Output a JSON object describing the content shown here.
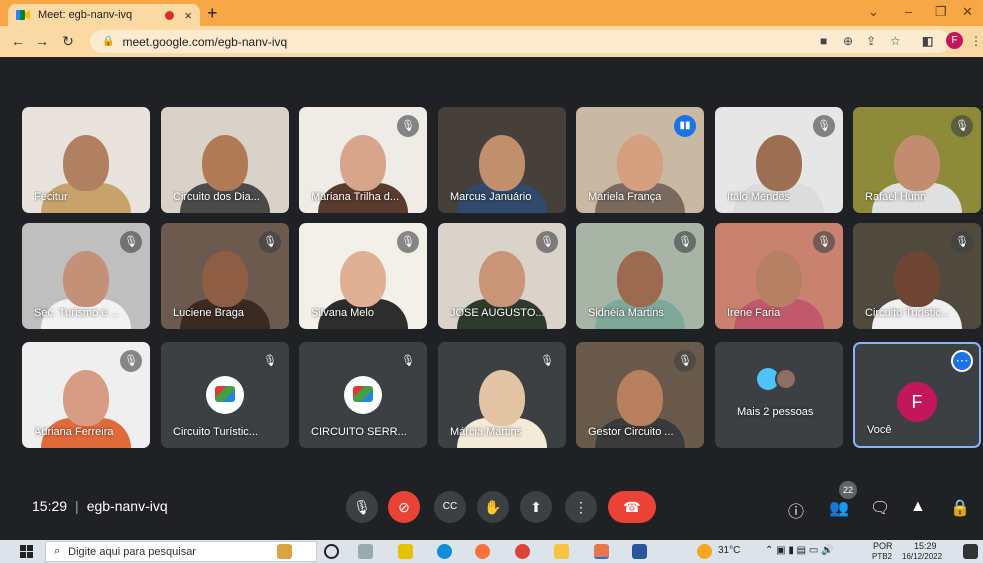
{
  "browser": {
    "tab_title": "Meet: egb-nanv-ivq",
    "tab_close": "×",
    "new_tab": "+",
    "url": "meet.google.com/egb-nanv-ivq",
    "profile_initial": "F"
  },
  "participants": [
    {
      "name": "Fecitur",
      "muted": false,
      "skin": "#b08060",
      "shirt": "#c9a26b",
      "bg": "#e8e3dc"
    },
    {
      "name": "Circuito dos Dia...",
      "muted": false,
      "skin": "#b07a55",
      "shirt": "#4a4a4a",
      "bg": "#d8d2c8"
    },
    {
      "name": "Mariana Trilha d...",
      "muted": true,
      "skin": "#d6a58a",
      "shirt": "#5a3b2e",
      "bg": "#efece7"
    },
    {
      "name": "Marcus Januário",
      "muted": false,
      "skin": "#c28f6c",
      "shirt": "#2f4a6b",
      "bg": "#46403b"
    },
    {
      "name": "Mariela França",
      "muted": false,
      "speaking": true,
      "skin": "#d4a07f",
      "shirt": "#7a6a5e",
      "bg": "#c9b9a2"
    },
    {
      "name": "Italo Mendes",
      "muted": true,
      "skin": "#9c6f52",
      "shirt": "#dcdcdc",
      "bg": "#e6e6e6"
    },
    {
      "name": "Rafael Huhn",
      "muted": true,
      "skin": "#c28d6e",
      "shirt": "#e0e0e0",
      "bg": "#8d8a3a"
    },
    {
      "name": "Sec. Turismo e ...",
      "muted": true,
      "skin": "#c49077",
      "shirt": "#f2f2f2",
      "bg": "#bfbfbf"
    },
    {
      "name": "Luciene Braga",
      "muted": true,
      "skin": "#8f5d43",
      "shirt": "#3b2a22",
      "bg": "#6b5a4d"
    },
    {
      "name": "Silvana Melo",
      "muted": true,
      "skin": "#e0b095",
      "shirt": "#2d2d2d",
      "bg": "#f3efe9"
    },
    {
      "name": "JOSE AUGUSTO...",
      "muted": true,
      "skin": "#c99578",
      "shirt": "#2f3a2f",
      "bg": "#d9d3c9"
    },
    {
      "name": "Sidnéia Martins",
      "muted": true,
      "skin": "#9b6a4f",
      "shirt": "#7fa89a",
      "bg": "#a8b5a6"
    },
    {
      "name": "Irene Faria",
      "muted": true,
      "skin": "#b58064",
      "shirt": "#c0596c",
      "bg": "#c9826f"
    },
    {
      "name": "Circuito Turístic...",
      "muted": true,
      "skin": "#6e4633",
      "shirt": "#f0f0f0",
      "bg": "#4f4a3d"
    },
    {
      "name": "Adriana Ferreira",
      "muted": true,
      "skin": "#d89c85",
      "shirt": "#e26a3a",
      "bg": "#efefef"
    },
    {
      "name": "Circuito Turístic...",
      "muted": true,
      "logo": true
    },
    {
      "name": "CIRCUITO SERR...",
      "muted": true,
      "logo": true
    },
    {
      "name": "Márcia Martins",
      "muted": true,
      "skin": "#e2c4a4",
      "shirt": "#f5ead8",
      "bg": "#3c4043"
    },
    {
      "name": "Gestor Circuito ...",
      "muted": true,
      "skin": "#b8805f",
      "shirt": "#3a3a3a",
      "bg": "#6a5a4b"
    }
  ],
  "more_people": "Mais 2 pessoas",
  "you": {
    "label": "Você",
    "initial": "F"
  },
  "meeting": {
    "time": "15:29",
    "code": "egb-nanv-ivq",
    "participant_count": "22"
  },
  "taskbar": {
    "search_placeholder": "Digite aqui para pesquisar",
    "temperature": "31°C",
    "lang": "POR",
    "lang2": "PTB2",
    "time": "15:29",
    "date": "16/12/2022"
  },
  "colors": {
    "tab_strip": "#f7a745",
    "meet_bg": "#202124",
    "hangup": "#ea4335",
    "accent": "#1a73e8"
  }
}
